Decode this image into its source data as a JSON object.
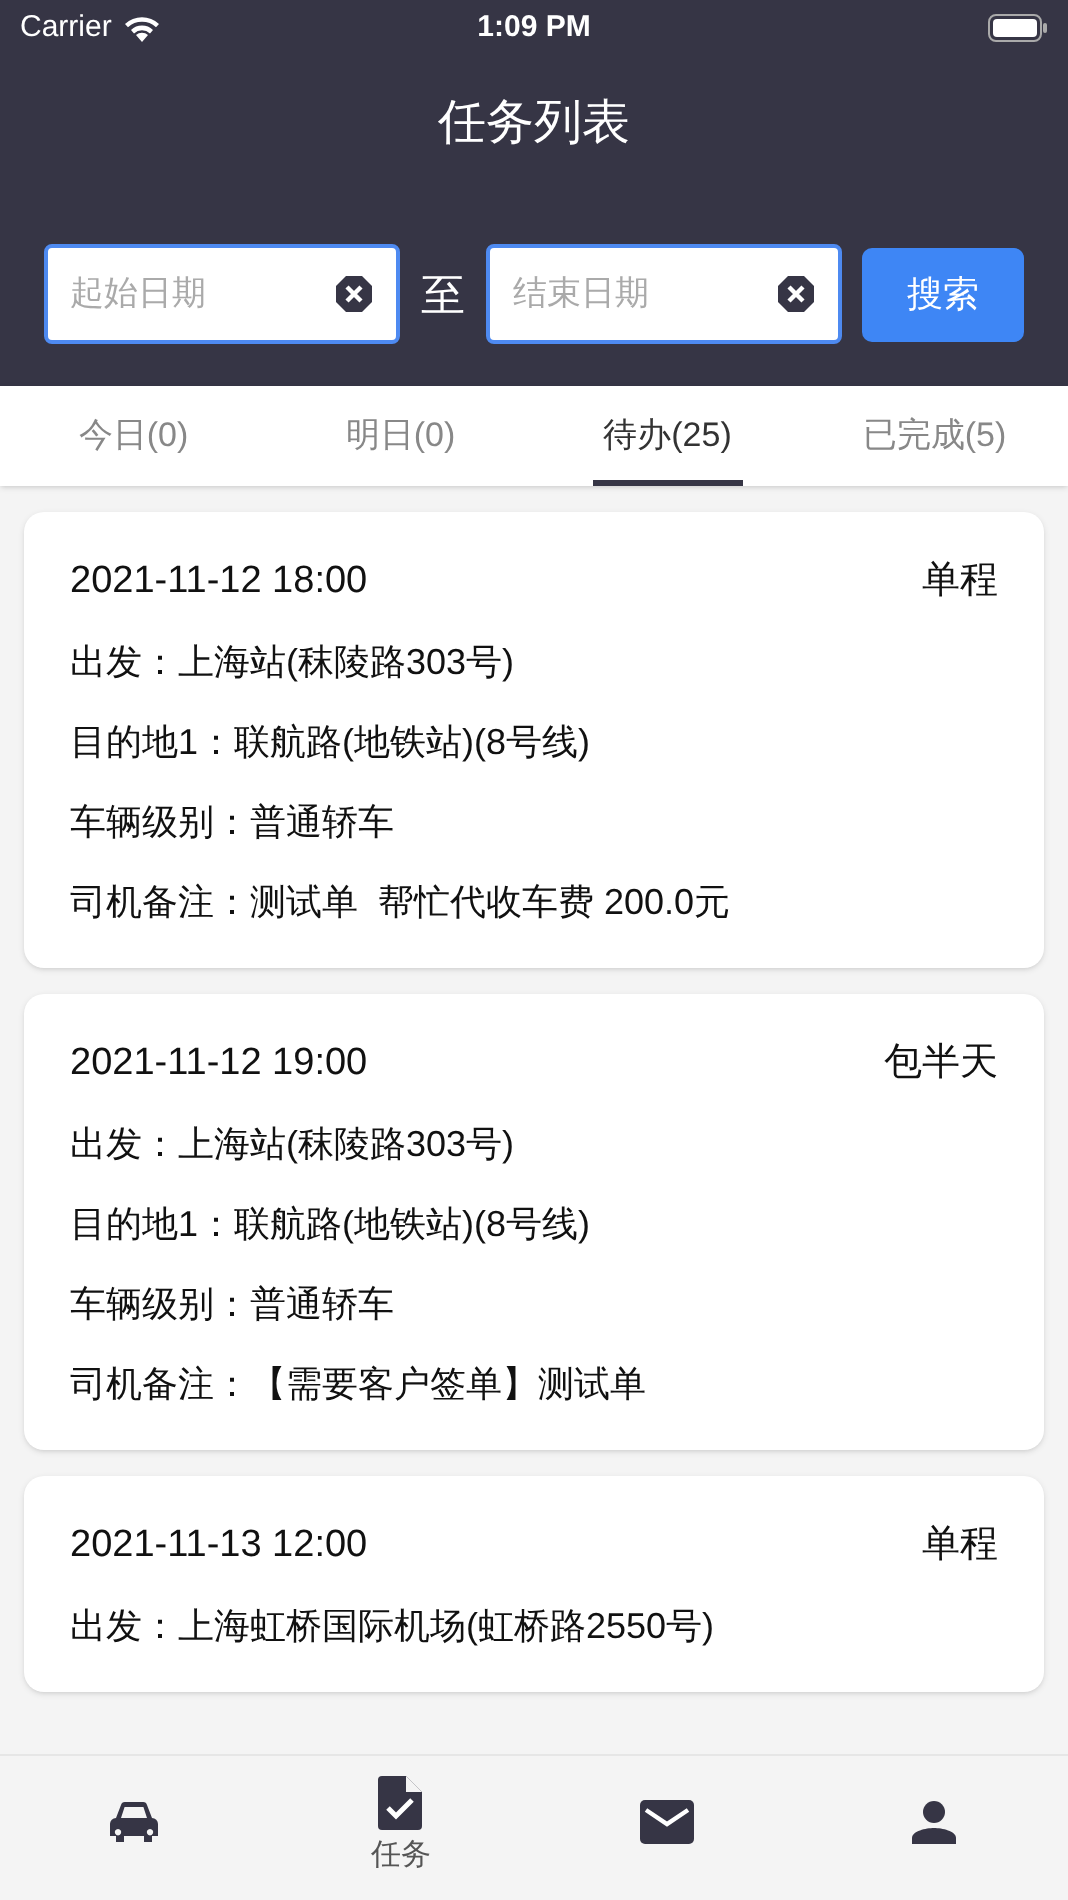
{
  "status_bar": {
    "carrier": "Carrier",
    "time": "1:09 PM"
  },
  "title": "任务列表",
  "filter": {
    "start": {
      "placeholder": "起始日期"
    },
    "separator": "至",
    "end": {
      "placeholder": "结束日期"
    },
    "search_button": "搜索"
  },
  "tabs": [
    {
      "label": "今日(0)",
      "selected": false
    },
    {
      "label": "明日(0)",
      "selected": false
    },
    {
      "label": "待办(25)",
      "selected": true
    },
    {
      "label": "已完成(5)",
      "selected": false
    }
  ],
  "tasks": [
    {
      "time": "2021-11-12 18:00",
      "type": "单程",
      "lines": [
        "出发：上海站(秣陵路303号)",
        "目的地1：联航路(地铁站)(8号线)",
        "车辆级别：普通轿车",
        "司机备注：测试单  帮忙代收车费 200.0元"
      ]
    },
    {
      "time": "2021-11-12 19:00",
      "type": "包半天",
      "lines": [
        "出发：上海站(秣陵路303号)",
        "目的地1：联航路(地铁站)(8号线)",
        "车辆级别：普通轿车",
        "司机备注：【需要客户签单】测试单"
      ]
    },
    {
      "time": "2021-11-13 12:00",
      "type": "单程",
      "lines": [
        "出发：上海虹桥国际机场(虹桥路2550号)"
      ]
    }
  ],
  "tab_bar": [
    {
      "kind": "car"
    },
    {
      "kind": "task",
      "label": "任务"
    },
    {
      "kind": "mail"
    },
    {
      "kind": "person"
    }
  ]
}
